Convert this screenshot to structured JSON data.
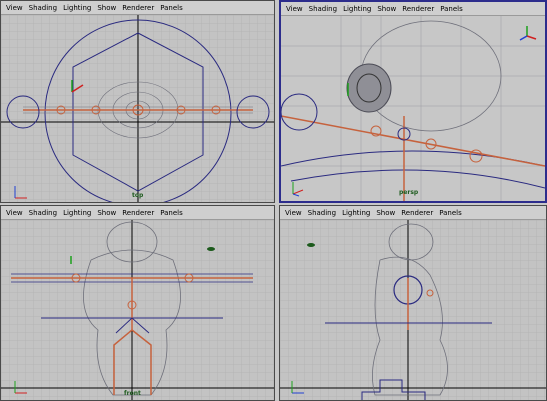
{
  "menu": [
    "View",
    "Shading",
    "Lighting",
    "Show",
    "Renderer",
    "Panels"
  ],
  "viewports": {
    "top": {
      "camera": "top"
    },
    "persp": {
      "camera": "persp"
    },
    "front": {
      "camera": "front"
    },
    "side": {
      "camera": ""
    }
  },
  "icons": [
    "axis-gizmo-icon",
    "view-cube-icon"
  ],
  "colors": {
    "grid": "#a9a9a9",
    "joint": "#c6623d",
    "mesh": "#6e6f7a",
    "handle": "#2a2a80",
    "active_border": "#2c2c8c"
  }
}
